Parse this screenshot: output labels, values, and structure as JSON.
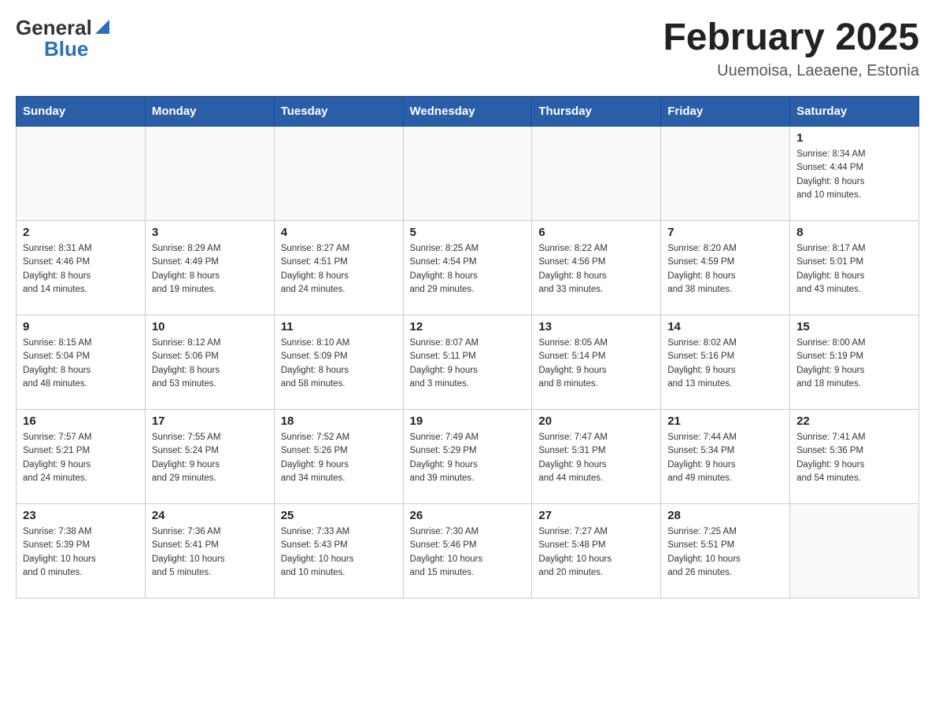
{
  "header": {
    "logo": {
      "general": "General",
      "blue": "Blue",
      "icon": "▲"
    },
    "title": "February 2025",
    "subtitle": "Uuemoisa, Laeaene, Estonia"
  },
  "weekdays": [
    "Sunday",
    "Monday",
    "Tuesday",
    "Wednesday",
    "Thursday",
    "Friday",
    "Saturday"
  ],
  "weeks": [
    [
      {
        "day": "",
        "info": ""
      },
      {
        "day": "",
        "info": ""
      },
      {
        "day": "",
        "info": ""
      },
      {
        "day": "",
        "info": ""
      },
      {
        "day": "",
        "info": ""
      },
      {
        "day": "",
        "info": ""
      },
      {
        "day": "1",
        "info": "Sunrise: 8:34 AM\nSunset: 4:44 PM\nDaylight: 8 hours\nand 10 minutes."
      }
    ],
    [
      {
        "day": "2",
        "info": "Sunrise: 8:31 AM\nSunset: 4:46 PM\nDaylight: 8 hours\nand 14 minutes."
      },
      {
        "day": "3",
        "info": "Sunrise: 8:29 AM\nSunset: 4:49 PM\nDaylight: 8 hours\nand 19 minutes."
      },
      {
        "day": "4",
        "info": "Sunrise: 8:27 AM\nSunset: 4:51 PM\nDaylight: 8 hours\nand 24 minutes."
      },
      {
        "day": "5",
        "info": "Sunrise: 8:25 AM\nSunset: 4:54 PM\nDaylight: 8 hours\nand 29 minutes."
      },
      {
        "day": "6",
        "info": "Sunrise: 8:22 AM\nSunset: 4:56 PM\nDaylight: 8 hours\nand 33 minutes."
      },
      {
        "day": "7",
        "info": "Sunrise: 8:20 AM\nSunset: 4:59 PM\nDaylight: 8 hours\nand 38 minutes."
      },
      {
        "day": "8",
        "info": "Sunrise: 8:17 AM\nSunset: 5:01 PM\nDaylight: 8 hours\nand 43 minutes."
      }
    ],
    [
      {
        "day": "9",
        "info": "Sunrise: 8:15 AM\nSunset: 5:04 PM\nDaylight: 8 hours\nand 48 minutes."
      },
      {
        "day": "10",
        "info": "Sunrise: 8:12 AM\nSunset: 5:06 PM\nDaylight: 8 hours\nand 53 minutes."
      },
      {
        "day": "11",
        "info": "Sunrise: 8:10 AM\nSunset: 5:09 PM\nDaylight: 8 hours\nand 58 minutes."
      },
      {
        "day": "12",
        "info": "Sunrise: 8:07 AM\nSunset: 5:11 PM\nDaylight: 9 hours\nand 3 minutes."
      },
      {
        "day": "13",
        "info": "Sunrise: 8:05 AM\nSunset: 5:14 PM\nDaylight: 9 hours\nand 8 minutes."
      },
      {
        "day": "14",
        "info": "Sunrise: 8:02 AM\nSunset: 5:16 PM\nDaylight: 9 hours\nand 13 minutes."
      },
      {
        "day": "15",
        "info": "Sunrise: 8:00 AM\nSunset: 5:19 PM\nDaylight: 9 hours\nand 18 minutes."
      }
    ],
    [
      {
        "day": "16",
        "info": "Sunrise: 7:57 AM\nSunset: 5:21 PM\nDaylight: 9 hours\nand 24 minutes."
      },
      {
        "day": "17",
        "info": "Sunrise: 7:55 AM\nSunset: 5:24 PM\nDaylight: 9 hours\nand 29 minutes."
      },
      {
        "day": "18",
        "info": "Sunrise: 7:52 AM\nSunset: 5:26 PM\nDaylight: 9 hours\nand 34 minutes."
      },
      {
        "day": "19",
        "info": "Sunrise: 7:49 AM\nSunset: 5:29 PM\nDaylight: 9 hours\nand 39 minutes."
      },
      {
        "day": "20",
        "info": "Sunrise: 7:47 AM\nSunset: 5:31 PM\nDaylight: 9 hours\nand 44 minutes."
      },
      {
        "day": "21",
        "info": "Sunrise: 7:44 AM\nSunset: 5:34 PM\nDaylight: 9 hours\nand 49 minutes."
      },
      {
        "day": "22",
        "info": "Sunrise: 7:41 AM\nSunset: 5:36 PM\nDaylight: 9 hours\nand 54 minutes."
      }
    ],
    [
      {
        "day": "23",
        "info": "Sunrise: 7:38 AM\nSunset: 5:39 PM\nDaylight: 10 hours\nand 0 minutes."
      },
      {
        "day": "24",
        "info": "Sunrise: 7:36 AM\nSunset: 5:41 PM\nDaylight: 10 hours\nand 5 minutes."
      },
      {
        "day": "25",
        "info": "Sunrise: 7:33 AM\nSunset: 5:43 PM\nDaylight: 10 hours\nand 10 minutes."
      },
      {
        "day": "26",
        "info": "Sunrise: 7:30 AM\nSunset: 5:46 PM\nDaylight: 10 hours\nand 15 minutes."
      },
      {
        "day": "27",
        "info": "Sunrise: 7:27 AM\nSunset: 5:48 PM\nDaylight: 10 hours\nand 20 minutes."
      },
      {
        "day": "28",
        "info": "Sunrise: 7:25 AM\nSunset: 5:51 PM\nDaylight: 10 hours\nand 26 minutes."
      },
      {
        "day": "",
        "info": ""
      }
    ]
  ]
}
